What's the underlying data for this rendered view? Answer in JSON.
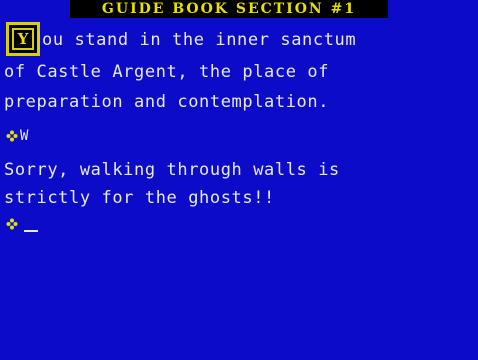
{
  "header": {
    "title": "GUIDE BOOK SECTION #1"
  },
  "dropcap": {
    "letter": "Y"
  },
  "description": {
    "line1": "ou stand in the inner sanctum",
    "line2": "of  Castle Argent,  the place of",
    "line3": "preparation and contemplation."
  },
  "input_history": {
    "last_command": "W"
  },
  "response": {
    "line1": "Sorry,  walking through walls is",
    "line2": "strictly for the ghosts!!"
  },
  "colors": {
    "background": "#0c0cc8",
    "text": "#e8e8e8",
    "title_text": "#e8e000",
    "title_box": "#000000",
    "border_yellow": "#d8d000"
  },
  "icons": {
    "prompt": "flower-prompt-icon"
  }
}
